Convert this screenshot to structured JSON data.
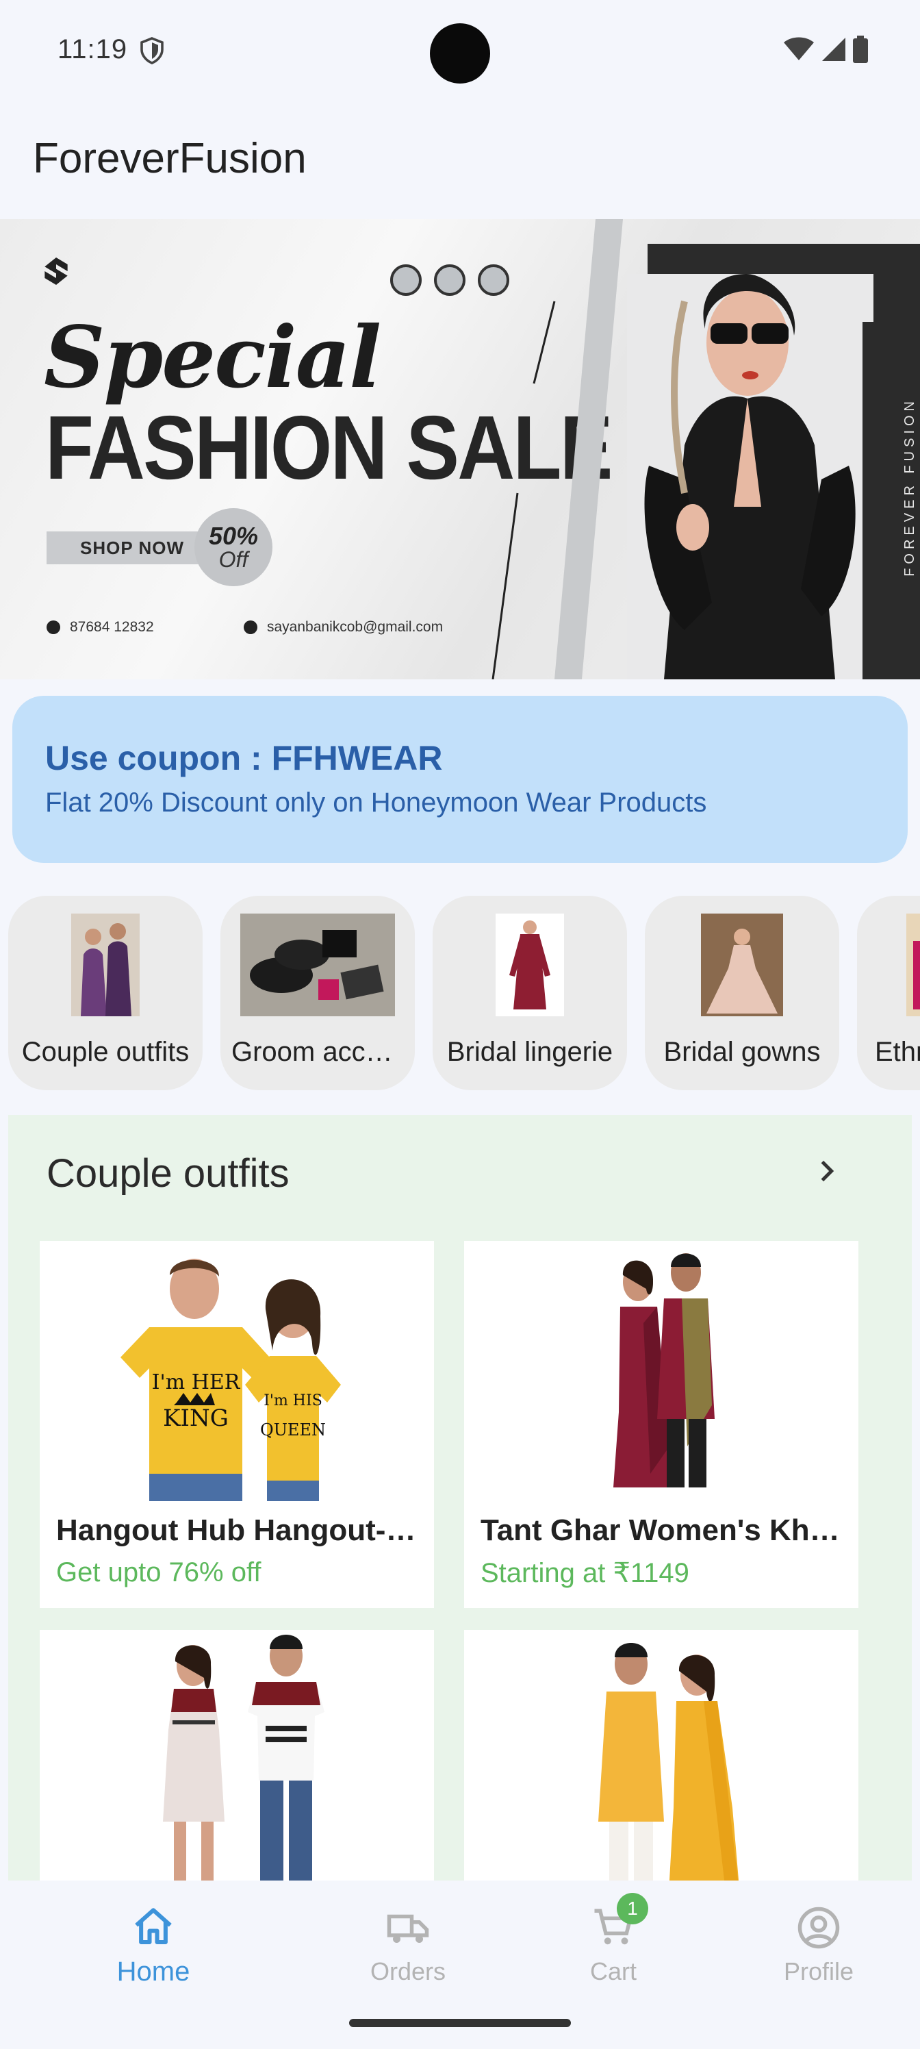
{
  "status_bar": {
    "time": "11:19"
  },
  "app": {
    "title": "ForeverFusion"
  },
  "banner": {
    "script_text": "Special",
    "headline": "FASHION SALE",
    "cta": "SHOP NOW",
    "discount_value": "50%",
    "discount_word": "Off",
    "phone": "87684 12832",
    "email": "sayanbanikcob@gmail.com",
    "vertical_brand": "FOREVER FUSION"
  },
  "coupon": {
    "title": "Use coupon : FFHWEAR",
    "subtitle": "Flat 20% Discount only on Honeymoon Wear Products"
  },
  "categories": [
    {
      "label": "Couple outfits",
      "icon": "couple-thumbnail"
    },
    {
      "label": "Groom accessories",
      "icon": "groom-accessories-thumbnail"
    },
    {
      "label": "Bridal lingerie",
      "icon": "bridal-lingerie-thumbnail"
    },
    {
      "label": "Bridal gowns",
      "icon": "bridal-gown-thumbnail"
    },
    {
      "label": "Ethnic wear",
      "icon": "ethnic-thumbnail"
    }
  ],
  "section": {
    "title": "Couple outfits",
    "products": [
      {
        "name": "Hangout Hub Hangout-Hub Couple T-shirt",
        "price": "Get upto 76% off"
      },
      {
        "name": "Tant Ghar Women's Khadi Saree",
        "price": "Starting at ₹1149"
      },
      {
        "name": "",
        "price": ""
      },
      {
        "name": "",
        "price": ""
      }
    ]
  },
  "nav": {
    "home": "Home",
    "orders": "Orders",
    "cart": "Cart",
    "cart_count": "1",
    "profile": "Profile"
  },
  "colors": {
    "accent": "#3d93da",
    "success": "#5cb85c",
    "coupon_bg": "#c2e0fa",
    "coupon_text": "#2a5fa8",
    "section_bg": "#e9f4ea"
  }
}
